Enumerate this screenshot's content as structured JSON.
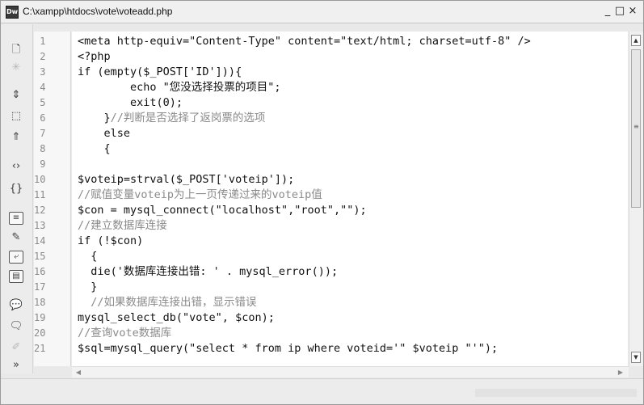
{
  "window": {
    "title": "C:\\xampp\\htdocs\\vote\\voteadd.php",
    "app_icon_text": "Dw",
    "minimize_glyph": "_",
    "maximize_glyph": "□",
    "close_glyph": "×"
  },
  "toolbar": {
    "items": [
      {
        "icon": "file-icon",
        "glyph": "🗋"
      },
      {
        "icon": "asterisk-icon",
        "glyph": "✳"
      },
      {
        "icon": "expand-icon",
        "glyph": "⇕"
      },
      {
        "icon": "select-block-icon",
        "glyph": "⬚"
      },
      {
        "icon": "collapse-icon",
        "glyph": "⇑"
      },
      {
        "icon": "tag-icon",
        "glyph": "‹›"
      },
      {
        "icon": "braces-icon",
        "glyph": "{}"
      },
      {
        "icon": "line-numbers-icon",
        "glyph": "≡"
      },
      {
        "icon": "highlight-icon",
        "glyph": "✎"
      },
      {
        "icon": "wrap-icon",
        "glyph": "⤶"
      },
      {
        "icon": "syntax-icon",
        "glyph": "▤"
      },
      {
        "icon": "comment-icon",
        "glyph": "💬"
      },
      {
        "icon": "uncomment-icon",
        "glyph": "🗨"
      },
      {
        "icon": "format-icon",
        "glyph": "✐"
      },
      {
        "icon": "more-icon",
        "glyph": "»"
      }
    ]
  },
  "editor": {
    "line_numbers": [
      "1",
      "2",
      "3",
      "4",
      "5",
      "6",
      "7",
      "8",
      "9",
      "10",
      "11",
      "12",
      "13",
      "14",
      "15",
      "16",
      "17",
      "18",
      "19",
      "20",
      "21"
    ],
    "lines": [
      "<meta http-equiv=\"Content-Type\" content=\"text/html; charset=utf-8\" />",
      "<?php",
      "if (empty($_POST['ID'])){",
      "        echo \"您没选择投票的项目\";",
      "        exit(0);",
      "    }//判断是否选择了返岗票的选项",
      "    else",
      "    {",
      "",
      "$voteip=strval($_POST['voteip']);",
      "//赋值变量voteip为上一页传递过来的voteip值",
      "$con = mysql_connect(\"localhost\",\"root\",\"\");",
      "//建立数据库连接",
      "if (!$con)",
      "  {",
      "  die('数据库连接出错: ' . mysql_error());",
      "  }",
      "  //如果数据库连接出错，显示错误",
      "mysql_select_db(\"vote\", $con);",
      "//查询vote数据库",
      "$sql=mysql_query(\"select * from ip where voteid='\" $voteip \"'\");"
    ]
  },
  "scrollbar": {
    "up_glyph": "▲",
    "down_glyph": "▼",
    "grip_glyph": "≡",
    "left_glyph": "◀",
    "right_glyph": "▶"
  }
}
